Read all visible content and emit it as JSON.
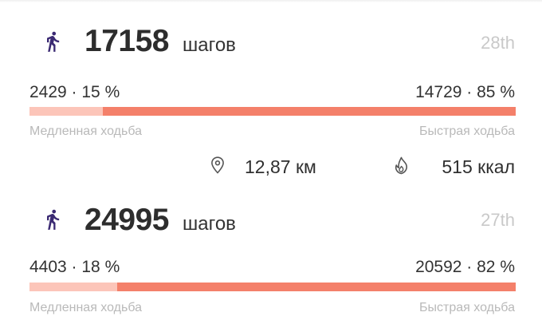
{
  "unit_steps": "шагов",
  "slow_caption": "Медленная ходьба",
  "fast_caption": "Быстрая ходьба",
  "colors": {
    "fast_bar": "#f4806a",
    "slow_bar": "#fcc5b9",
    "walker_icon": "#3b2a73",
    "muted_text": "#b9b9b9"
  },
  "days": [
    {
      "steps": "17158",
      "day": "28th",
      "slow": "2429 · 15 %",
      "fast": "14729 · 85 %",
      "slow_fraction": 0.15,
      "distance": "12,87 км",
      "calories": "515 ккал",
      "icons": {
        "walker": "walking-person-icon",
        "location": "location-pin-icon",
        "flame": "flame-icon"
      }
    },
    {
      "steps": "24995",
      "day": "27th",
      "slow": "4403 · 18 %",
      "fast": "20592 · 82 %",
      "slow_fraction": 0.18,
      "icons": {
        "walker": "walking-person-icon"
      }
    }
  ]
}
